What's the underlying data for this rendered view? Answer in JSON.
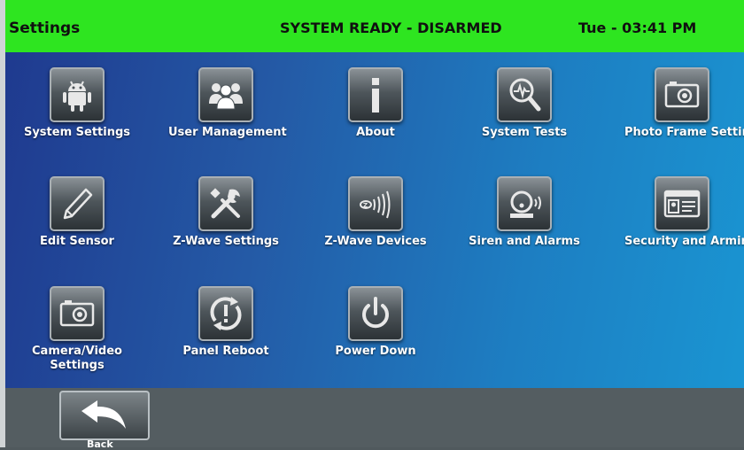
{
  "status_bar": {
    "title": "Settings",
    "system_state": "SYSTEM READY - DISARMED",
    "datetime": "Tue - 03:41 PM",
    "color": "#2ee520"
  },
  "tiles": [
    {
      "label": "System Settings",
      "icon": "android-icon"
    },
    {
      "label": "User Management",
      "icon": "users-icon"
    },
    {
      "label": "About",
      "icon": "info-icon"
    },
    {
      "label": "System Tests",
      "icon": "magnifier-pulse-icon"
    },
    {
      "label": "Photo Frame Settings",
      "icon": "camera-icon"
    },
    {
      "label": "Edit Sensor",
      "icon": "pencil-icon"
    },
    {
      "label": "Z-Wave Settings",
      "icon": "wrench-screwdriver-icon"
    },
    {
      "label": "Z-Wave Devices",
      "icon": "zwave-signal-icon"
    },
    {
      "label": "Siren and Alarms",
      "icon": "siren-icon"
    },
    {
      "label": "Security and Arming",
      "icon": "id-card-icon"
    },
    {
      "label": "Camera/Video",
      "label2": "Settings",
      "icon": "camera-icon"
    },
    {
      "label": "Panel Reboot",
      "icon": "reboot-icon"
    },
    {
      "label": "Power Down",
      "icon": "power-icon"
    }
  ],
  "footer": {
    "back_label": "Back",
    "back_icon": "back-arrow-icon"
  }
}
